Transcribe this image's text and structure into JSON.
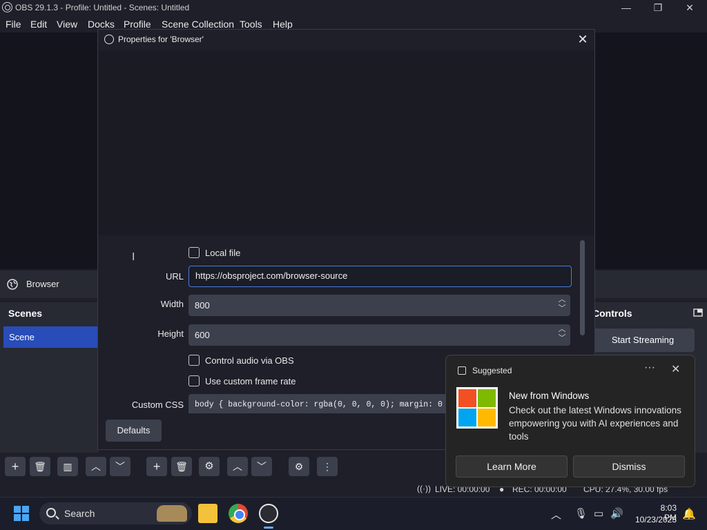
{
  "window": {
    "title": "OBS 29.1.3 - Profile: Untitled - Scenes: Untitled"
  },
  "menu": [
    "File",
    "Edit",
    "View",
    "Docks",
    "Profile",
    "Scene Collection",
    "Tools",
    "Help"
  ],
  "source_bar": {
    "label": "Browser"
  },
  "scenes": {
    "header": "Scenes",
    "items": [
      "Scene"
    ]
  },
  "controls": {
    "header": "Controls",
    "start_streaming": "Start Streaming"
  },
  "status": {
    "live": "LIVE: 00:00:00",
    "rec": "REC: 00:00:00",
    "cpu": "CPU: 27.4%, 30.00 fps"
  },
  "dialog": {
    "title": "Properties for 'Browser'",
    "local_file_label": "Local file",
    "url_label": "URL",
    "url_value": "https://obsproject.com/browser-source",
    "width_label": "Width",
    "width_value": "800",
    "height_label": "Height",
    "height_value": "600",
    "control_audio_label": "Control audio via OBS",
    "custom_frame_rate_label": "Use custom frame rate",
    "custom_css_label": "Custom CSS",
    "custom_css_value": "body { background-color: rgba(0, 0, 0, 0); margin: 0",
    "defaults_button": "Defaults"
  },
  "notification": {
    "header": "Suggested",
    "title": "New from Windows",
    "body": "Check out the latest Windows innovations empowering you with AI experiences and tools",
    "learn_more": "Learn More",
    "dismiss": "Dismiss"
  },
  "taskbar": {
    "search_placeholder": "Search",
    "time": "8:03 PM",
    "date": "10/23/2023"
  },
  "colors": {
    "accent": "#284cb8",
    "url_focus": "#4a7dd8",
    "ms_red": "#f25022",
    "ms_green": "#7fba00",
    "ms_blue": "#00a4ef",
    "ms_yellow": "#ffb900"
  }
}
